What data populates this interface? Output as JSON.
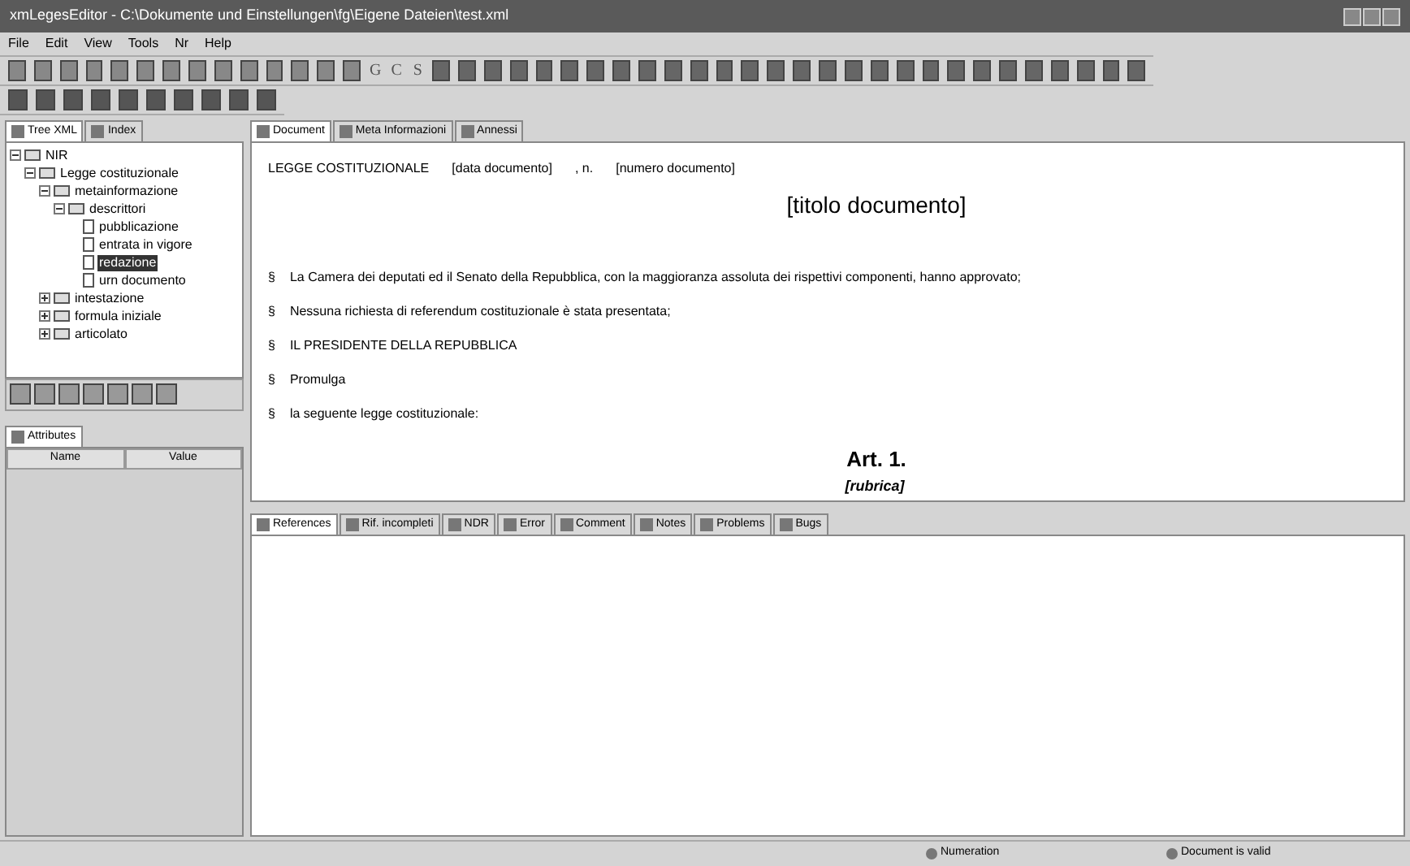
{
  "window": {
    "title": "xmLegesEditor - C:\\Dokumente und Einstellungen\\fg\\Eigene Dateien\\test.xml"
  },
  "menu": [
    "File",
    "Edit",
    "View",
    "Tools",
    "Nr",
    "Help"
  ],
  "toolbar_letters": [
    "G",
    "C",
    "S"
  ],
  "left_tabs": [
    {
      "label": "Tree XML",
      "selected": true
    },
    {
      "label": "Index",
      "selected": false
    }
  ],
  "tree": [
    {
      "label": "NIR",
      "expanded": true,
      "selected": false,
      "children": [
        {
          "label": "Legge costituzionale",
          "expanded": true,
          "selected": false,
          "children": [
            {
              "label": "metainformazione",
              "expanded": true,
              "selected": false,
              "children": [
                {
                  "label": "descrittori",
                  "expanded": true,
                  "selected": false,
                  "children": [
                    {
                      "label": "pubblicazione",
                      "selected": false
                    },
                    {
                      "label": "entrata in vigore",
                      "selected": false
                    },
                    {
                      "label": "redazione",
                      "selected": true
                    },
                    {
                      "label": "urn documento",
                      "selected": false
                    }
                  ]
                }
              ]
            },
            {
              "label": "intestazione",
              "kind": "folder",
              "expanded": false,
              "selected": false
            },
            {
              "label": "formula iniziale",
              "kind": "folder",
              "expanded": false,
              "selected": false
            },
            {
              "label": "articolato",
              "kind": "folder",
              "expanded": false,
              "selected": false
            }
          ]
        }
      ]
    }
  ],
  "attributes": {
    "tab": "Attributes",
    "columns": [
      "Name",
      "Value"
    ]
  },
  "doc_tabs": [
    {
      "label": "Document",
      "selected": true
    },
    {
      "label": "Meta Informazioni",
      "selected": false
    },
    {
      "label": "Annessi",
      "selected": false
    }
  ],
  "document": {
    "header": [
      "LEGGE COSTITUZIONALE",
      "[data documento]",
      ", n.",
      "[numero documento]"
    ],
    "title": "[titolo documento]",
    "paragraphs": [
      "La Camera dei deputati ed il Senato della Repubblica, con la maggioranza assoluta dei rispettivi componenti, hanno approvato;",
      "Nessuna richiesta di referendum costituzionale è stata presentata;",
      "IL PRESIDENTE DELLA REPUBBLICA",
      "Promulga",
      "la seguente legge costituzionale:"
    ],
    "section_mark": "§",
    "article": "Art. 1.",
    "rubric": "[rubrica]"
  },
  "bottom_tabs": [
    {
      "label": "References",
      "selected": true
    },
    {
      "label": "Rif. incompleti",
      "selected": false
    },
    {
      "label": "NDR",
      "selected": false
    },
    {
      "label": "Error",
      "selected": false
    },
    {
      "label": "Comment",
      "selected": false
    },
    {
      "label": "Notes",
      "selected": false
    },
    {
      "label": "Problems",
      "selected": false
    },
    {
      "label": "Bugs",
      "selected": false
    }
  ],
  "status_bar": [
    "Numeration",
    "Document is valid"
  ]
}
